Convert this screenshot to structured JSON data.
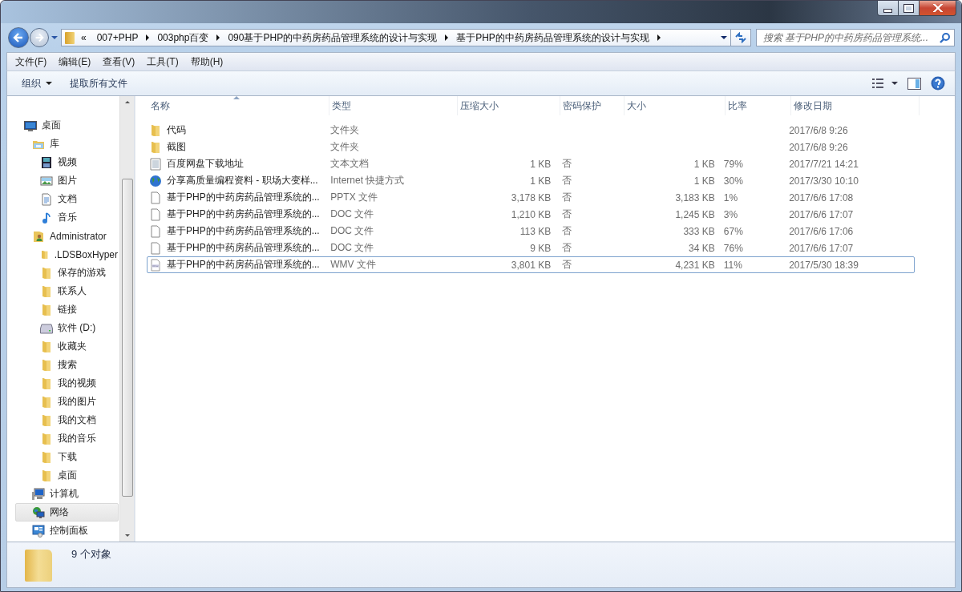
{
  "address_bar": {
    "segments": [
      "«",
      "007+PHP",
      "003php百变",
      "090基于PHP的中药房药品管理系统的设计与实现",
      "基于PHP的中药房药品管理系统的设计与实现"
    ]
  },
  "search": {
    "placeholder": "搜索 基于PHP的中药房药品管理系统..."
  },
  "menu_bar": [
    "文件(F)",
    "编辑(E)",
    "查看(V)",
    "工具(T)",
    "帮助(H)"
  ],
  "toolbar": {
    "buttons": [
      {
        "label": "组织",
        "dropdown": true
      },
      {
        "label": "提取所有文件",
        "dropdown": false
      }
    ]
  },
  "sidebar": {
    "items": [
      {
        "label": "桌面",
        "kind": "desktop",
        "selected": false,
        "children": [
          {
            "label": "库",
            "kind": "library",
            "selected": false,
            "children": [
              {
                "label": "视频",
                "kind": "video",
                "selected": false
              },
              {
                "label": "图片",
                "kind": "picture",
                "selected": false
              },
              {
                "label": "文档",
                "kind": "document",
                "selected": false
              },
              {
                "label": "音乐",
                "kind": "music",
                "selected": false
              }
            ]
          },
          {
            "label": "Administrator",
            "kind": "user",
            "selected": false,
            "children": [
              {
                "label": ".LDSBoxHyper",
                "kind": "folder",
                "selected": false
              },
              {
                "label": "保存的游戏",
                "kind": "folder",
                "selected": false
              },
              {
                "label": "联系人",
                "kind": "folder",
                "selected": false
              },
              {
                "label": "链接",
                "kind": "folder",
                "selected": false
              },
              {
                "label": "软件 (D:)",
                "kind": "drive",
                "selected": false
              },
              {
                "label": "收藏夹",
                "kind": "folder",
                "selected": false
              },
              {
                "label": "搜索",
                "kind": "folder",
                "selected": false
              },
              {
                "label": "我的视频",
                "kind": "folder",
                "selected": false
              },
              {
                "label": "我的图片",
                "kind": "folder",
                "selected": false
              },
              {
                "label": "我的文档",
                "kind": "folder",
                "selected": false
              },
              {
                "label": "我的音乐",
                "kind": "folder",
                "selected": false
              },
              {
                "label": "下载",
                "kind": "folder",
                "selected": false
              },
              {
                "label": "桌面",
                "kind": "folder",
                "selected": false
              }
            ]
          },
          {
            "label": "计算机",
            "kind": "computer",
            "selected": false
          },
          {
            "label": "网络",
            "kind": "network",
            "selected": true
          },
          {
            "label": "控制面板",
            "kind": "control-panel",
            "selected": false
          }
        ]
      }
    ]
  },
  "table": {
    "columns": [
      "名称",
      "类型",
      "压缩大小",
      "密码保护",
      "大小",
      "比率",
      "修改日期"
    ],
    "rows": [
      {
        "kind": "folder",
        "focused": false,
        "cells": [
          "代码",
          "文件夹",
          "",
          "",
          "",
          "",
          "2017/6/8 9:26"
        ]
      },
      {
        "kind": "folder",
        "focused": false,
        "cells": [
          "截图",
          "文件夹",
          "",
          "",
          "",
          "",
          "2017/6/8 9:26"
        ]
      },
      {
        "kind": "text",
        "focused": false,
        "cells": [
          "百度网盘下载地址",
          "文本文档",
          "1 KB",
          "否",
          "1 KB",
          "79%",
          "2017/7/21 14:21"
        ]
      },
      {
        "kind": "web",
        "focused": false,
        "cells": [
          "分享高质量编程资料 - 职场大变样...",
          "Internet 快捷方式",
          "1 KB",
          "否",
          "1 KB",
          "30%",
          "2017/3/30 10:10"
        ]
      },
      {
        "kind": "file",
        "focused": false,
        "cells": [
          "基于PHP的中药房药品管理系统的...",
          "PPTX 文件",
          "3,178 KB",
          "否",
          "3,183 KB",
          "1%",
          "2017/6/6 17:08"
        ]
      },
      {
        "kind": "file",
        "focused": false,
        "cells": [
          "基于PHP的中药房药品管理系统的...",
          "DOC 文件",
          "1,210 KB",
          "否",
          "1,245 KB",
          "3%",
          "2017/6/6 17:07"
        ]
      },
      {
        "kind": "file",
        "focused": false,
        "cells": [
          "基于PHP的中药房药品管理系统的...",
          "DOC 文件",
          "113 KB",
          "否",
          "333 KB",
          "67%",
          "2017/6/6 17:06"
        ]
      },
      {
        "kind": "file",
        "focused": false,
        "cells": [
          "基于PHP的中药房药品管理系统的...",
          "DOC 文件",
          "9 KB",
          "否",
          "34 KB",
          "76%",
          "2017/6/6 17:07"
        ]
      },
      {
        "kind": "video",
        "focused": true,
        "cells": [
          "基于PHP的中药房药品管理系统的...",
          "WMV 文件",
          "3,801 KB",
          "否",
          "4,231 KB",
          "11%",
          "2017/5/30 18:39"
        ]
      }
    ]
  },
  "status_bar": {
    "text": "9 个对象"
  }
}
